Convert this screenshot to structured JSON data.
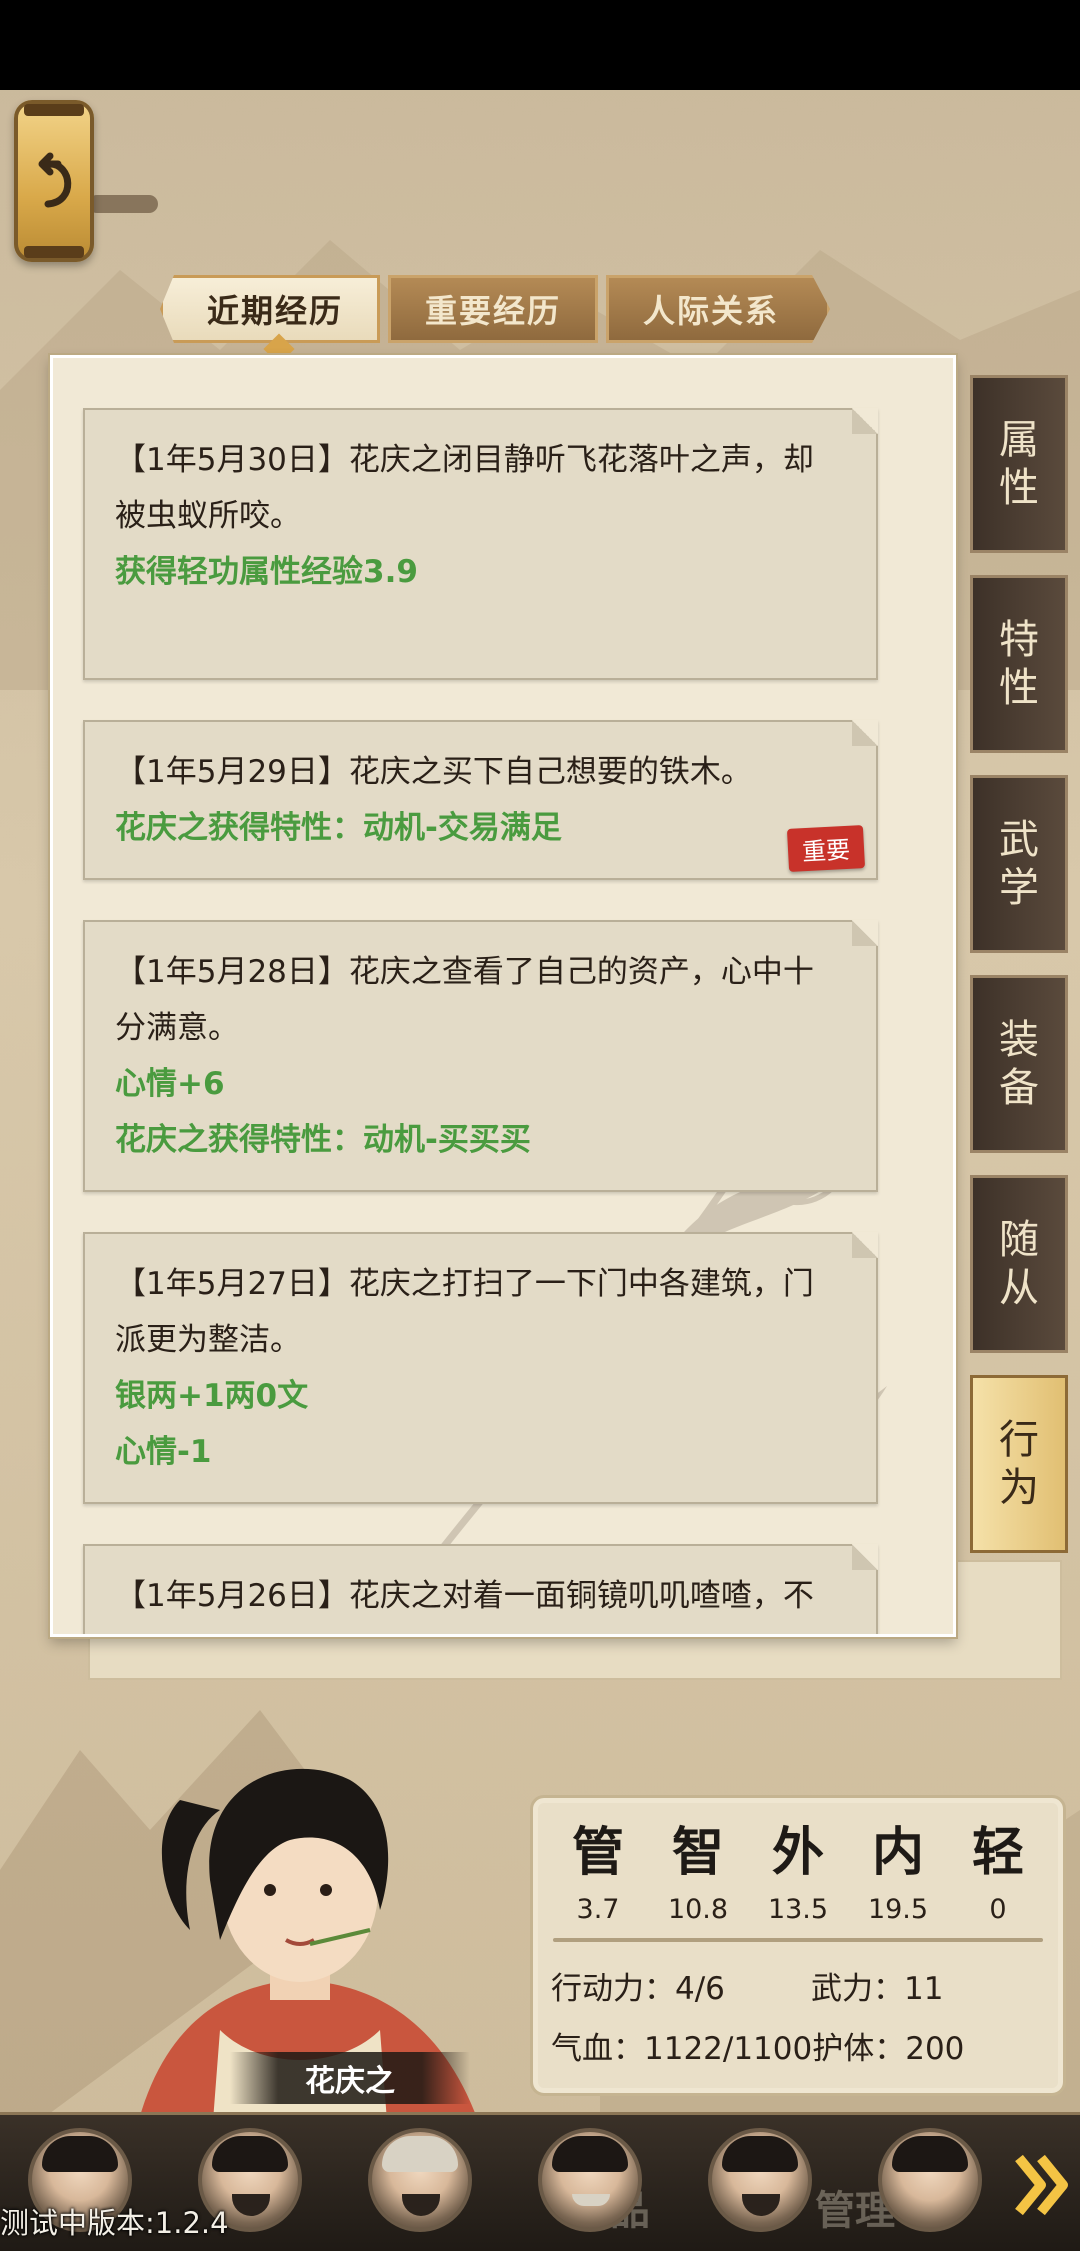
{
  "tabs": [
    {
      "label": "近期经历",
      "active": true
    },
    {
      "label": "重要经历",
      "active": false
    },
    {
      "label": "人际关系",
      "active": false
    }
  ],
  "entries": [
    {
      "lines": [
        "【1年5月30日】花庆之闭目静听飞花落叶之声，却",
        "被虫蚁所咬。"
      ],
      "effects": [
        "获得轻功属性经验3.9"
      ],
      "badge": ""
    },
    {
      "lines": [
        "【1年5月29日】花庆之买下自己想要的铁木。"
      ],
      "effects": [
        "花庆之获得特性：动机-交易满足"
      ],
      "badge": "重要"
    },
    {
      "lines": [
        "【1年5月28日】花庆之查看了自己的资产，心中十",
        "分满意。"
      ],
      "effects": [
        "心情+6",
        "花庆之获得特性：动机-买买买"
      ],
      "badge": ""
    },
    {
      "lines": [
        "【1年5月27日】花庆之打扫了一下门中各建筑，门",
        "派更为整洁。"
      ],
      "effects": [
        "银两+1两0文",
        "心情-1"
      ],
      "badge": ""
    },
    {
      "lines": [
        "【1年5月26日】花庆之对着一面铜镜叽叽喳喳，不"
      ],
      "effects": [],
      "badge": ""
    }
  ],
  "side_tabs": [
    {
      "label": "属性",
      "chars": [
        "属",
        "性"
      ],
      "active": false
    },
    {
      "label": "特性",
      "chars": [
        "特",
        "性"
      ],
      "active": false
    },
    {
      "label": "武学",
      "chars": [
        "武",
        "学"
      ],
      "active": false
    },
    {
      "label": "装备",
      "chars": [
        "装",
        "备"
      ],
      "active": false
    },
    {
      "label": "随从",
      "chars": [
        "随",
        "从"
      ],
      "active": false
    },
    {
      "label": "行为",
      "chars": [
        "行",
        "为"
      ],
      "active": true
    }
  ],
  "character": {
    "name": "花庆之"
  },
  "stats": {
    "attributes": [
      {
        "char": "管",
        "value": "3.7"
      },
      {
        "char": "智",
        "value": "10.8"
      },
      {
        "char": "外",
        "value": "13.5"
      },
      {
        "char": "内",
        "value": "19.5"
      },
      {
        "char": "轻",
        "value": "0"
      }
    ],
    "action_power": "行动力：4/6",
    "force": "武力：11",
    "hp_armor": "气血：1122/1100护体：200"
  },
  "bottom_bar": {
    "ghost_labels": [
      "品",
      "管理"
    ],
    "next_icon": "double-chevron-right-icon"
  },
  "version": "测试中版本:1.2.4",
  "icons": {
    "back": "undo-arrow-icon"
  },
  "colors": {
    "green_effect": "#4a9b3f",
    "badge_red": "#c8322a",
    "active_side_tab": "#e1bf72"
  }
}
